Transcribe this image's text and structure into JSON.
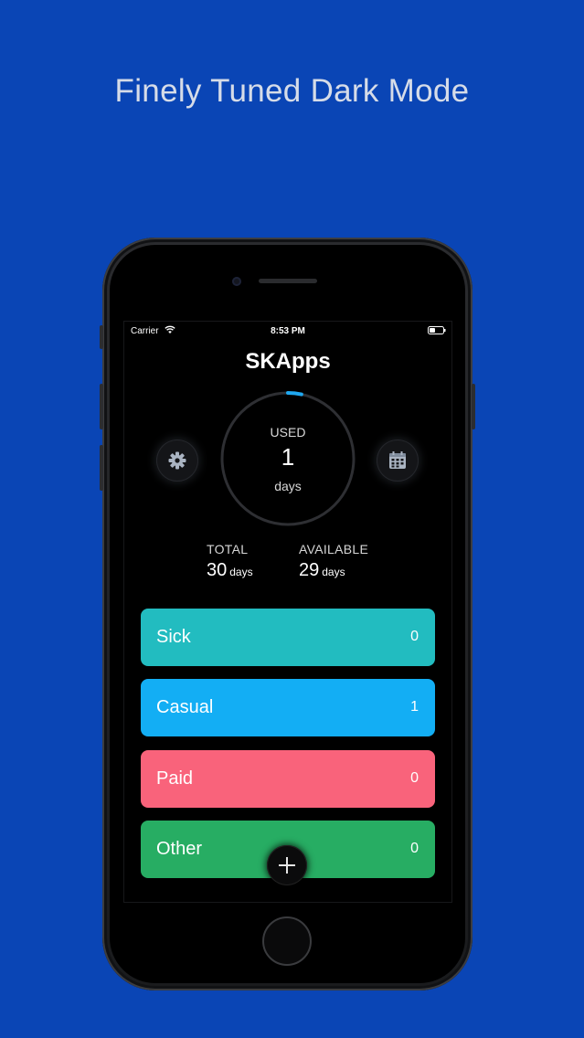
{
  "headline": "Finely Tuned Dark Mode",
  "status_bar": {
    "carrier": "Carrier",
    "time": "8:53 PM"
  },
  "app": {
    "title": "SKApps"
  },
  "ring": {
    "label": "USED",
    "value": "1",
    "unit": "days",
    "progress_fraction": 0.033,
    "accent_color": "#1fa8f0"
  },
  "buttons": {
    "settings_icon": "gear-icon",
    "calendar_icon": "calendar-icon",
    "add_icon": "plus-icon"
  },
  "stats": {
    "total": {
      "label": "TOTAL",
      "value": "30",
      "unit": "days"
    },
    "available": {
      "label": "AVAILABLE",
      "value": "29",
      "unit": "days"
    }
  },
  "leave_types": [
    {
      "name": "Sick",
      "count": "0",
      "color": "#22bcc0"
    },
    {
      "name": "Casual",
      "count": "1",
      "color": "#13aef4"
    },
    {
      "name": "Paid",
      "count": "0",
      "color": "#f9637b"
    },
    {
      "name": "Other",
      "count": "0",
      "color": "#27ad63"
    }
  ],
  "colors": {
    "background": "#0a45b5",
    "screen": "#000000"
  }
}
